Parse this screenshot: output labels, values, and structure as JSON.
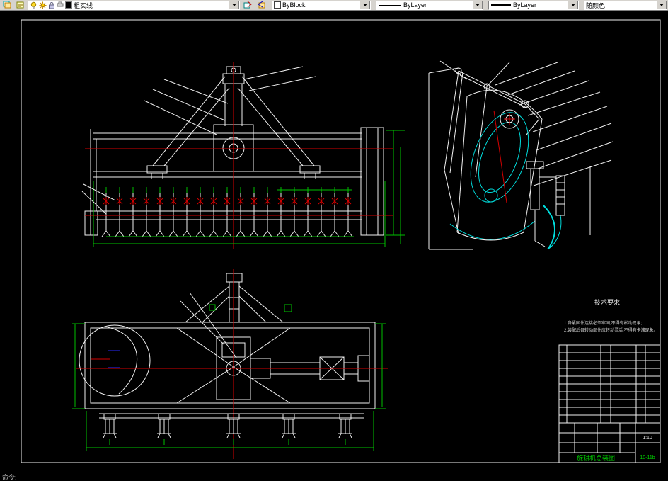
{
  "toolbar": {
    "layer": {
      "value": "粗实线"
    },
    "color": {
      "value": "ByBlock"
    },
    "linetype": {
      "value": "ByLayer"
    },
    "lineweight": {
      "value": "ByLayer"
    },
    "plot_style": {
      "value": "随颜色"
    }
  },
  "drawing": {
    "tech_requirements": {
      "title": "技术要求",
      "line1": "1.各紧固件连接必须牢固,不得有松动现象;",
      "line2": "2.装配后各转动部件应转动灵活,不得有卡滞现象。"
    },
    "title_block": {
      "name": "旋耕机总装图",
      "drawing_no": "10-11b",
      "scale": "1:10"
    },
    "command_text": "命令:"
  }
}
